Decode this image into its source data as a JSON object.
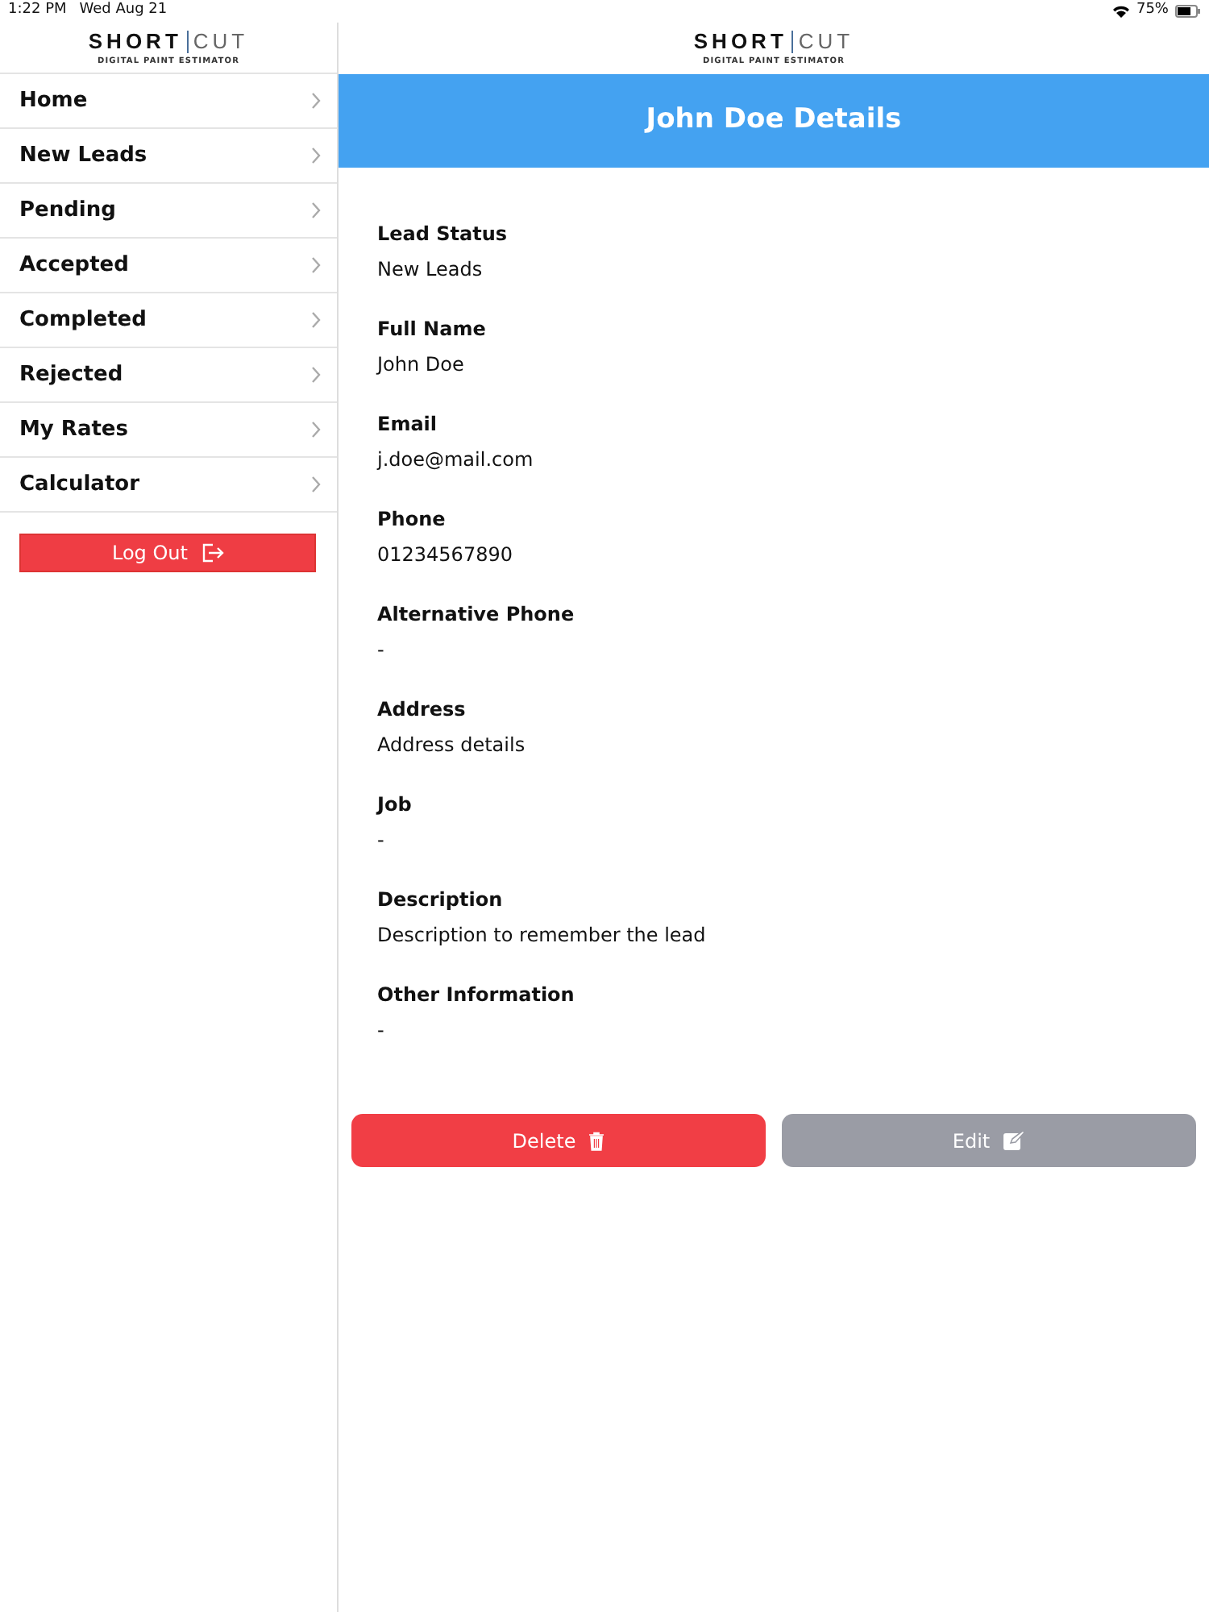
{
  "status_bar": {
    "time": "1:22 PM",
    "date": "Wed Aug 21",
    "battery": "75%"
  },
  "logos": [
    {
      "left": "SHORT",
      "right": "CUT",
      "tagline": "DIGITAL PAINT ESTIMATOR"
    },
    {
      "left": "SHORT",
      "right": "CUT",
      "tagline": "DIGITAL PAINT ESTIMATOR"
    }
  ],
  "sidebar": {
    "items": [
      {
        "label": "Home",
        "selected": false
      },
      {
        "label": "New Leads",
        "selected": false
      },
      {
        "label": "Pending",
        "selected": false
      },
      {
        "label": "Accepted",
        "selected": false
      },
      {
        "label": "Completed",
        "selected": false
      },
      {
        "label": "Rejected",
        "selected": false
      },
      {
        "label": "My Rates",
        "selected": false
      },
      {
        "label": "Calculator",
        "selected": false
      }
    ],
    "logout": "Log Out"
  },
  "header": {
    "title": "John Doe Details"
  },
  "fields": [
    {
      "label": "Lead Status",
      "value": "New Leads"
    },
    {
      "label": "Full Name",
      "value": "John Doe"
    },
    {
      "label": "Email",
      "value": "j.doe@mail.com"
    },
    {
      "label": "Phone",
      "value": "01234567890"
    },
    {
      "label": "Alternative Phone",
      "value": "-"
    },
    {
      "label": "Address",
      "value": "Address details"
    },
    {
      "label": "Job",
      "value": "-"
    },
    {
      "label": "Description",
      "value": "Description to remember the lead"
    },
    {
      "label": "Other Information",
      "value": "-"
    }
  ],
  "buttons": [
    {
      "label": "Delete",
      "kind": "delete"
    },
    {
      "label": "Edit",
      "kind": "edit"
    }
  ]
}
